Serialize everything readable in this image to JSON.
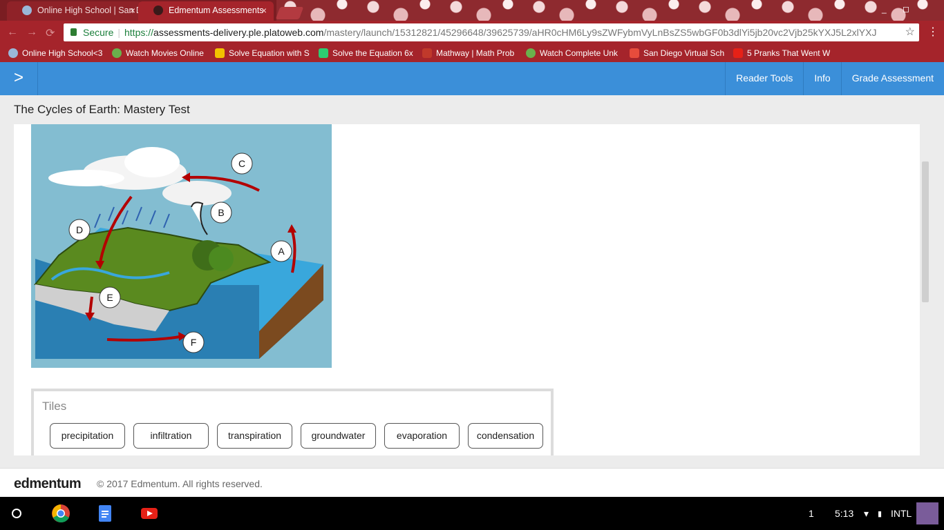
{
  "browser": {
    "tabs": [
      {
        "title": "Online High School | San Diego",
        "favicon_color": "#9ab7d8",
        "active": false
      },
      {
        "title": "Edmentum Assessments",
        "favicon_color": "#3a1a1a",
        "active": true
      }
    ],
    "close_glyph": "×",
    "omnibox": {
      "secure_label": "Secure",
      "scheme": "https://",
      "host": "assessments-delivery.ple.platoweb.com",
      "path": "/mastery/launch/15312821/45296648/39625739/aHR0cHM6Ly9sZWFybmVyLnBsZS5wbGF0b3dlYi5jb20vc2Vjb25kYXJ5L2xlYXJ"
    },
    "bookmarks": [
      {
        "label": "Online High School<3",
        "icon_color": "#9ab7d8"
      },
      {
        "label": "Watch Movies Online",
        "icon_color": "#6ab04c"
      },
      {
        "label": "Solve Equation with S",
        "icon_color": "#f2c200"
      },
      {
        "label": "Solve the Equation 6x",
        "icon_color": "#2ecc71"
      },
      {
        "label": "Mathway | Math Prob",
        "icon_color": "#c0392b"
      },
      {
        "label": "Watch Complete Unk",
        "icon_color": "#6ab04c"
      },
      {
        "label": "San Diego Virtual Sch",
        "icon_color": "#e74c3c"
      },
      {
        "label": "5 Pranks That Went W",
        "icon_color": "#e62117"
      }
    ]
  },
  "appbar": {
    "expand_glyph": ">",
    "nav": [
      "Reader Tools",
      "Info",
      "Grade Assessment"
    ],
    "color": "#3b8fd9"
  },
  "content": {
    "test_title": "The Cycles of Earth: Mastery Test",
    "diagram_labels": [
      "A",
      "B",
      "C",
      "D",
      "E",
      "F"
    ],
    "tiles_heading": "Tiles",
    "tiles": [
      "precipitation",
      "infiltration",
      "transpiration",
      "groundwater",
      "evaporation",
      "condensation"
    ]
  },
  "footer": {
    "logo": "edmentum",
    "copyright": "© 2017 Edmentum. All rights reserved."
  },
  "shelf": {
    "notification_count": "1",
    "time": "5:13",
    "input_method": "INTL"
  }
}
